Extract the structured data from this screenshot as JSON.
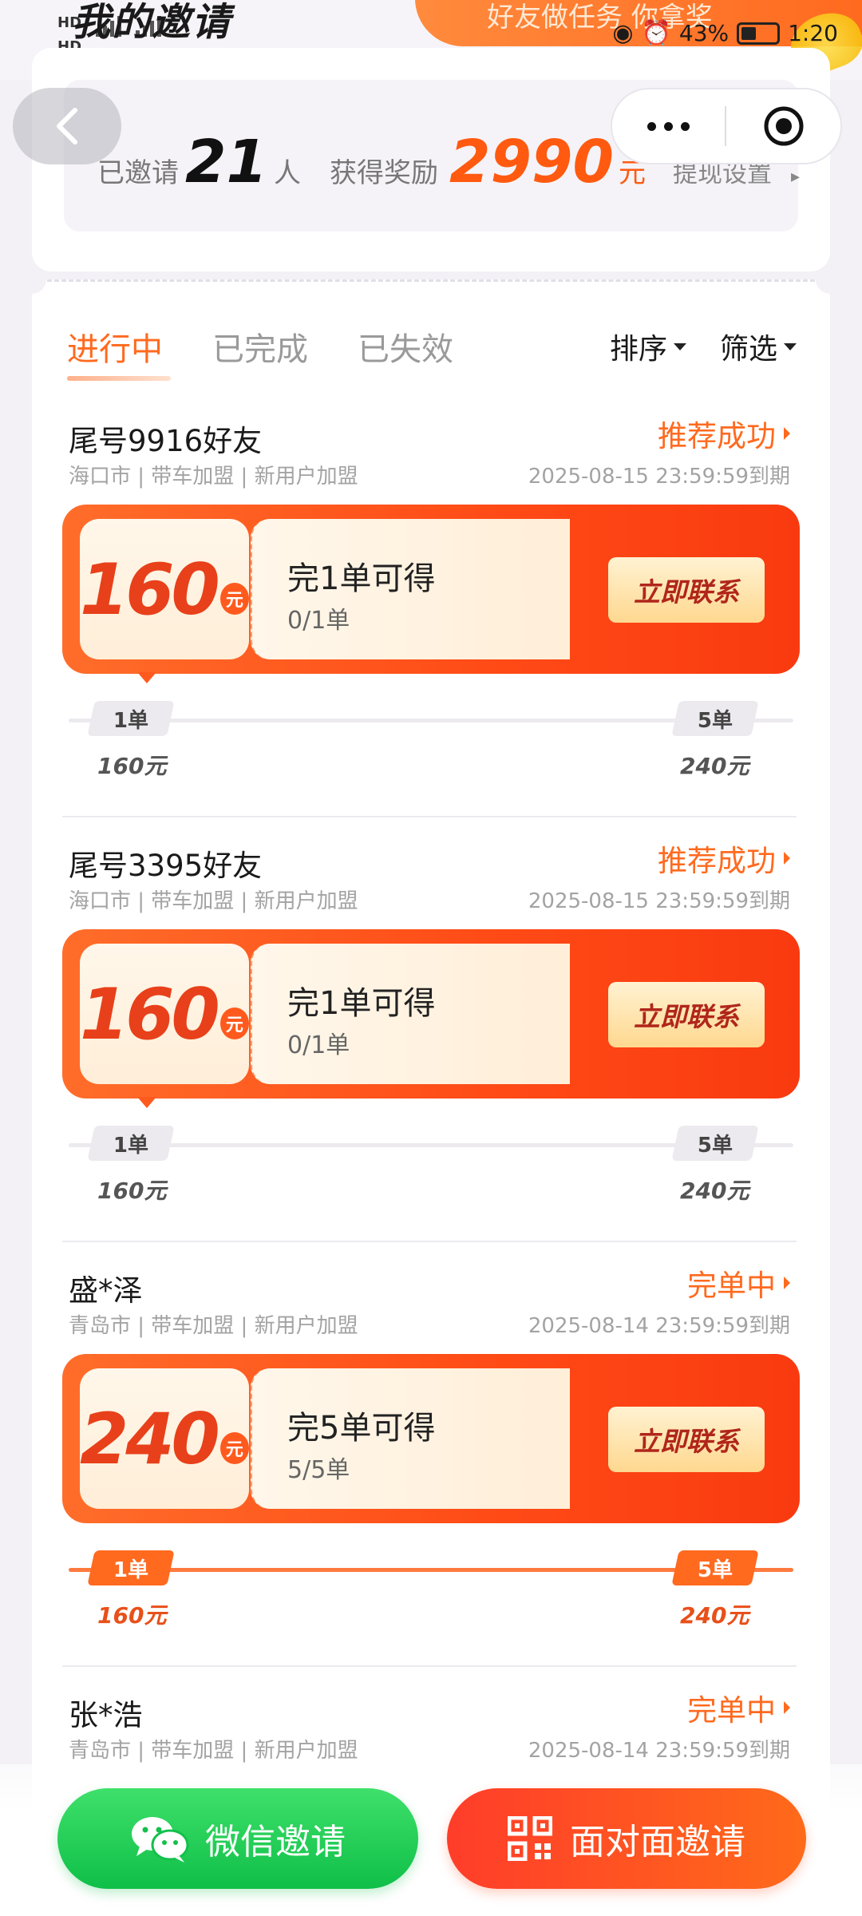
{
  "header": {
    "title": "我的邀请",
    "banner_text": "好友做任务 你拿奖",
    "network_1": "HD",
    "network_2": "HD",
    "battery_percent": "43%",
    "time": "1:20"
  },
  "stats": {
    "invited_label": "已邀请",
    "invited_count": "21",
    "invited_unit": "人",
    "reward_label": "获得奖励",
    "reward_amount": "2990",
    "reward_unit": "元",
    "withdraw_label": "提现设置"
  },
  "tabs": [
    {
      "label": "进行中",
      "active": true
    },
    {
      "label": "已完成",
      "active": false
    },
    {
      "label": "已失效",
      "active": false
    }
  ],
  "sort_label": "排序",
  "filter_label": "筛选",
  "items": [
    {
      "name": "尾号9916好友",
      "status": "推荐成功",
      "meta": "海口市 | 带车加盟 | 新用户加盟",
      "expiry": "2025-08-15 23:59:59到期",
      "amount": "160",
      "yuan": "元",
      "task": "完1单可得",
      "progress": "0/1单",
      "contact": "立即联系",
      "stage1_tag": "1单",
      "stage1_amount": "160元",
      "stage2_tag": "5单",
      "stage2_amount": "240元"
    },
    {
      "name": "尾号3395好友",
      "status": "推荐成功",
      "meta": "海口市 | 带车加盟 | 新用户加盟",
      "expiry": "2025-08-15 23:59:59到期",
      "amount": "160",
      "yuan": "元",
      "task": "完1单可得",
      "progress": "0/1单",
      "contact": "立即联系",
      "stage1_tag": "1单",
      "stage1_amount": "160元",
      "stage2_tag": "5单",
      "stage2_amount": "240元"
    },
    {
      "name": "盛*泽",
      "status": "完单中",
      "meta": "青岛市 | 带车加盟 | 新用户加盟",
      "expiry": "2025-08-14 23:59:59到期",
      "amount": "240",
      "yuan": "元",
      "task": "完5单可得",
      "progress": "5/5单",
      "contact": "立即联系",
      "stage1_tag": "1单",
      "stage1_amount": "160元",
      "stage2_tag": "5单",
      "stage2_amount": "240元"
    },
    {
      "name": "张*浩",
      "status": "完单中",
      "meta": "青岛市 | 带车加盟 | 新用户加盟",
      "expiry": "2025-08-14 23:59:59到期"
    }
  ],
  "bottom": {
    "wechat_invite": "微信邀请",
    "f2f_invite": "面对面邀请"
  },
  "colors": {
    "accent": "#ff6a1f",
    "green": "#0fbf48"
  }
}
